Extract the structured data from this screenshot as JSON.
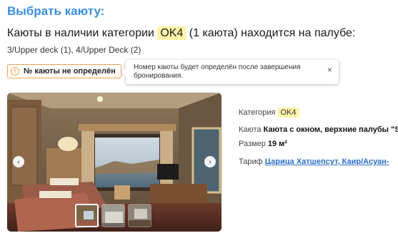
{
  "heading": "Выбрать каюту:",
  "availability": {
    "prefix": "Каюты в наличии категории",
    "category": "OK4",
    "suffix": "(1 каюта) находится на палубе:"
  },
  "decks": "3/Upper deck (1), 4/Upper Deck (2)",
  "cabin_status": {
    "icon": "!",
    "label": "№ каюты не определён"
  },
  "tooltip": {
    "text": "Номер каюты будет определён после завершения бронирования.",
    "close": "×"
  },
  "gallery": {
    "prev": "‹",
    "next": "›",
    "thumbnail_count": 3,
    "active_thumbnail": 1
  },
  "details": {
    "category_label": "Категория",
    "category_value": "OK4",
    "cabin_label": "Каюта",
    "cabin_value": "Каюта с окном, верхние палубы \"St",
    "size_label": "Размер",
    "size_value": "19 м²",
    "tariff_label": "Тариф",
    "tariff_value": "Царица Хатшепсут, Каир/Асуан-"
  },
  "colors": {
    "heading": "#3a8de0",
    "highlight": "#fff3a8",
    "warning": "#f0a04b",
    "link": "#2a6fc9"
  }
}
